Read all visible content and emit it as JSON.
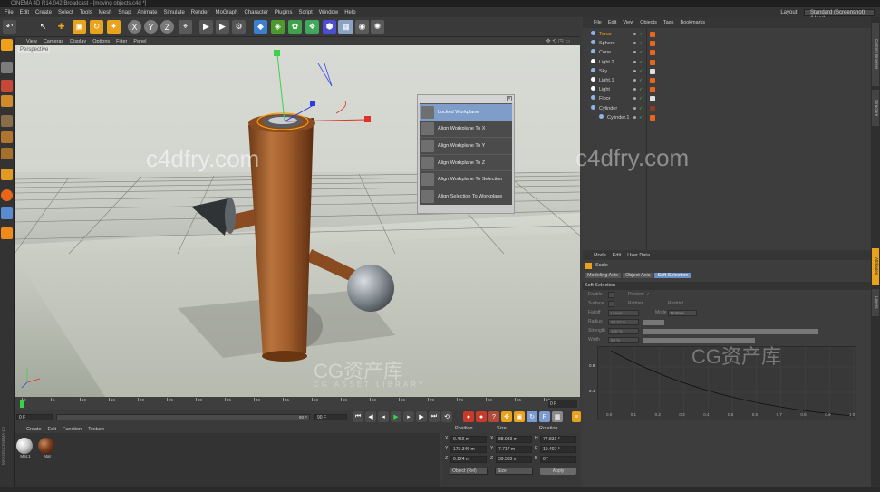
{
  "window_title": "CINEMA 4D R14.042 Broadcast - [moving objects.c4d *]",
  "menu": [
    "File",
    "Edit",
    "Create",
    "Select",
    "Tools",
    "Mesh",
    "Snap",
    "Animate",
    "Simulate",
    "Render",
    "MoGraph",
    "Character",
    "Plugins",
    "Script",
    "Window",
    "Help"
  ],
  "layout": {
    "label": "Layout:",
    "value": "Standard (Screenshot) (User)"
  },
  "viewport_menu": [
    "View",
    "Cameras",
    "Display",
    "Options",
    "Filter",
    "Panel"
  ],
  "viewport_label": "Perspective",
  "popup": {
    "items": [
      {
        "label": "Locked Workplane",
        "active": true
      },
      {
        "label": "Align Workplane To X",
        "active": false
      },
      {
        "label": "Align Workplane To Y",
        "active": false
      },
      {
        "label": "Align Workplane To Z",
        "active": false
      },
      {
        "label": "Align Workplane To Selection",
        "active": false
      },
      {
        "label": "Align Selection To Workplane",
        "active": false
      }
    ]
  },
  "watermarks": {
    "c4dfry": "c4dfry.com",
    "cg_cn": "CG资产库",
    "cg_en": "CG ASSET LIBRARY"
  },
  "timeline": {
    "ticks": [
      "0",
      "5",
      "10",
      "15",
      "20",
      "25",
      "30",
      "35",
      "40",
      "45",
      "50",
      "55",
      "60",
      "65",
      "70",
      "75",
      "80",
      "85",
      "90"
    ],
    "end_frame": "0 F"
  },
  "playbar": {
    "start": "0 F",
    "current": "0 F",
    "end": "90 F",
    "max": "90 F"
  },
  "material_menu": [
    "Create",
    "Edit",
    "Function",
    "Texture"
  ],
  "materials": [
    {
      "name": "Mat.1",
      "color": "#d4d4d4"
    },
    {
      "name": "Mat",
      "color": "#7a3d1d"
    }
  ],
  "coords": {
    "headers": [
      "Position",
      "Size",
      "Rotation"
    ],
    "rows": [
      {
        "axis": "X",
        "pos": "0.456 m",
        "size_axis": "X",
        "size": "88.983 m",
        "rot_axis": "H",
        "rot": "77.831 °"
      },
      {
        "axis": "Y",
        "pos": "175.346 m",
        "size_axis": "Y",
        "size": "7.717 m",
        "rot_axis": "P",
        "rot": "19.407 °"
      },
      {
        "axis": "Z",
        "pos": "0.124 m",
        "size_axis": "Z",
        "size": "39.583 m",
        "rot_axis": "B",
        "rot": "0 °"
      }
    ],
    "mode": "Object (Rel)",
    "size_mode": "Size",
    "apply": "Apply"
  },
  "object_manager": {
    "menu": [
      "File",
      "Edit",
      "View",
      "Objects",
      "Tags",
      "Bookmarks"
    ],
    "objects": [
      {
        "name": "Torus",
        "indent": 0,
        "selected": true
      },
      {
        "name": "Sphere",
        "indent": 0
      },
      {
        "name": "Cone",
        "indent": 0
      },
      {
        "name": "Light.2",
        "indent": 0
      },
      {
        "name": "Sky",
        "indent": 0
      },
      {
        "name": "Light.1",
        "indent": 0
      },
      {
        "name": "Light",
        "indent": 0
      },
      {
        "name": "Floor",
        "indent": 0
      },
      {
        "name": "Cylinder",
        "indent": 0
      },
      {
        "name": "Cylinder.1",
        "indent": 1
      }
    ]
  },
  "attribute_manager": {
    "menu": [
      "Mode",
      "Edit",
      "User Data"
    ],
    "tool": "Scale",
    "tabs": [
      "Modeling Axis",
      "Object Axis",
      "Soft Selection"
    ],
    "active_tab": "Soft Selection",
    "section": "Soft Selection",
    "fields": [
      {
        "label": "Enable",
        "value": ""
      },
      {
        "label": "Surface",
        "value": ""
      },
      {
        "label": "Falloff",
        "value": "Linear"
      },
      {
        "label": "Radius",
        "value": "39.37 m"
      },
      {
        "label": "Strength",
        "value": "100 %"
      },
      {
        "label": "Width",
        "value": "50 %"
      }
    ],
    "extra_fields": [
      {
        "label": "Preview",
        "value": "✓"
      },
      {
        "label": "Rubber",
        "value": ""
      },
      {
        "label": "Restrict",
        "value": ""
      },
      {
        "label": "Mode",
        "value": "Normal"
      }
    ],
    "graph_y": [
      "0.8",
      "0.4"
    ],
    "graph_x": [
      "0.0",
      "0.1",
      "0.2",
      "0.3",
      "0.4",
      "0.5",
      "0.6",
      "0.7",
      "0.8",
      "0.9",
      "1.0"
    ]
  },
  "right_tabs": [
    "Content Browser",
    "Structure",
    "Attributes",
    "Layers"
  ],
  "side_label": "MAXON CINEMA 4D"
}
